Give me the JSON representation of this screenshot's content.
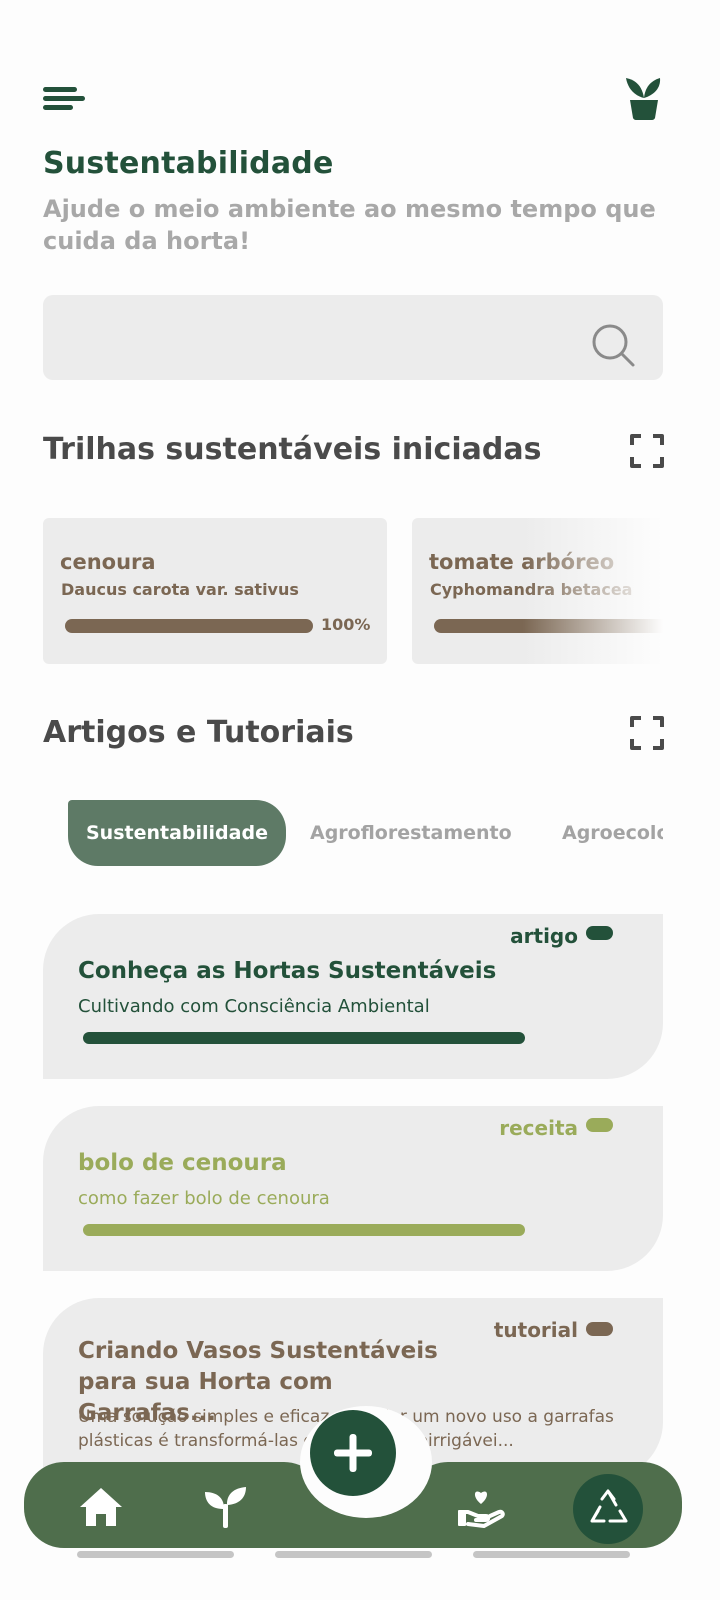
{
  "header": {
    "title": "Sustentabilidade",
    "subtitle": "Ajude o meio ambiente ao mesmo tempo que cuida da horta!"
  },
  "search": {
    "value": "",
    "placeholder": ""
  },
  "trails_section": {
    "title": "Trilhas sustentáveis iniciadas",
    "cards": [
      {
        "name": "cenoura",
        "scientific": "Daucus carota var. sativus",
        "progress_label": "100%",
        "progress": 1.0
      },
      {
        "name": "tomate arbóreo",
        "scientific": "Cyphomandra betacea",
        "progress": 1.0
      }
    ]
  },
  "articles_section": {
    "title": "Artigos e Tutoriais",
    "tabs": [
      "Sustentabilidade",
      "Agroflorestamento",
      "Agroecologia"
    ],
    "active_tab": "Sustentabilidade",
    "items": [
      {
        "tag": "artigo",
        "title": "Conheça as Hortas Sustentáveis",
        "description": "Cultivando com Consciência Ambiental",
        "color": "#23513a"
      },
      {
        "tag": "receita",
        "title": "bolo de cenoura",
        "description": "como fazer bolo de cenoura",
        "color": "#9aab5a"
      },
      {
        "tag": "tutorial",
        "title": "Criando Vasos Sustentáveis para sua Horta com Garrafas...",
        "description": "Uma solução simples e eficaz para dar um novo uso a garrafas plásticas é transformá-las em vasos autoirrigávei...",
        "color": "#7b6753"
      }
    ]
  },
  "colors": {
    "primary_dark": "#23513a",
    "nav_green": "#4f6e4c",
    "tab_active": "#5e7a66",
    "brown": "#7b6753",
    "olive": "#9aab5a",
    "card_bg": "#ececec"
  },
  "bottom_nav": {
    "items": [
      "home-icon",
      "sprout-icon",
      "add-icon",
      "hand-heart-icon",
      "recycle-icon"
    ]
  }
}
